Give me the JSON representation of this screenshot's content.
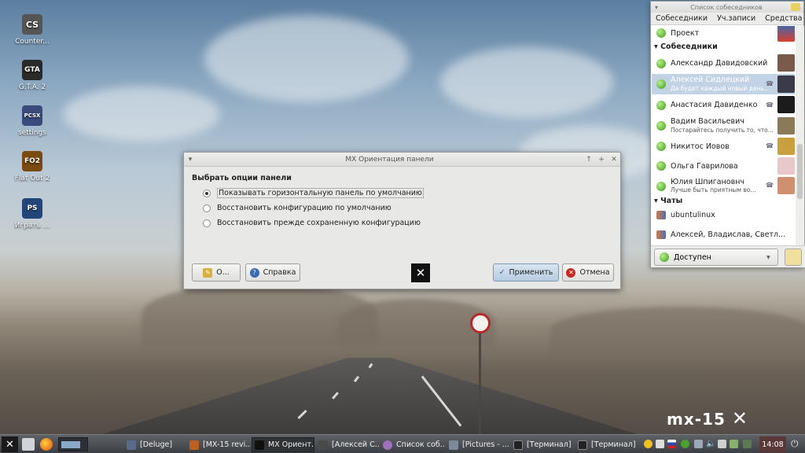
{
  "desktop": {
    "icons": [
      {
        "label": "Counter...",
        "badge": "CS",
        "color": "#555555"
      },
      {
        "label": "G.T.A. 2",
        "badge": "GTA",
        "color": "#2a2a2a"
      },
      {
        "label": "settings",
        "badge": "PCSX",
        "color": "#3a4a7a"
      },
      {
        "label": "Flat Out 2",
        "badge": "FO2",
        "color": "#7a4a10"
      },
      {
        "label": "Играть ...",
        "badge": "PS",
        "color": "#23467a"
      }
    ],
    "brand": "mx-15"
  },
  "dialog": {
    "title": "MX Ориентация панели",
    "section": "Выбрать опции панели",
    "options": [
      {
        "label": "Показывать горизонтальную панель по умолчанию",
        "selected": true
      },
      {
        "label": "Восстановить конфигурацию по умолчанию",
        "selected": false
      },
      {
        "label": "Восстановить прежде сохраненную конфигурацию",
        "selected": false
      }
    ],
    "about_label": "О...",
    "help_label": "Справка",
    "apply_label": "Применить",
    "cancel_label": "Отмена",
    "titlebar_icons": [
      "chevron-down-icon",
      "arrow-up-icon",
      "plus-icon",
      "close-icon"
    ]
  },
  "contacts": {
    "title": "Список собеседников",
    "menu": [
      "Собеседники",
      "Уч.записи",
      "Средства"
    ],
    "top": {
      "name": "Проект"
    },
    "group_contacts": "Собеседники",
    "people": [
      {
        "name": "Александр Давидовский",
        "status": "",
        "phone": false,
        "avatar": "#7a5a4a"
      },
      {
        "name": "Алексей Сидлецкий",
        "status": "Да будет каждый новый день...",
        "phone": true,
        "avatar": "#3a3a4a",
        "selected": true
      },
      {
        "name": "Анастасия Давиденко",
        "status": "",
        "phone": true,
        "avatar": "#1c1c1c"
      },
      {
        "name": "Вадим Васильевич",
        "status": "Постарайтесь получить то, что...",
        "phone": false,
        "avatar": "#8a7a5a"
      },
      {
        "name": "Никитос Иовов",
        "status": "",
        "phone": true,
        "avatar": "#c8a040"
      },
      {
        "name": "Ольга Гаврилова",
        "status": "",
        "phone": false,
        "avatar": "#e8c8c8"
      },
      {
        "name": "Юлия Шпигановнч",
        "status": "Лучше быть приятным во...",
        "phone": true,
        "avatar": "#d09070"
      }
    ],
    "group_chats": "Чаты",
    "chats": [
      "ubuntulinux",
      "Алексей, Владислав, Светл..."
    ],
    "presence": "Доступен"
  },
  "taskbar": {
    "tasks": [
      {
        "label": "[Deluge]",
        "active": false
      },
      {
        "label": "[MX-15 revi...",
        "active": false
      },
      {
        "label": "MX Ориент...",
        "active": true
      },
      {
        "label": "[Алексей С...",
        "active": false
      },
      {
        "label": "Список соб...",
        "active": false
      },
      {
        "label": "[Pictures - ...",
        "active": false
      },
      {
        "label": "[Терминал]",
        "active": false
      },
      {
        "label": "[Терминал]",
        "active": false
      }
    ],
    "clock": "14:08"
  }
}
